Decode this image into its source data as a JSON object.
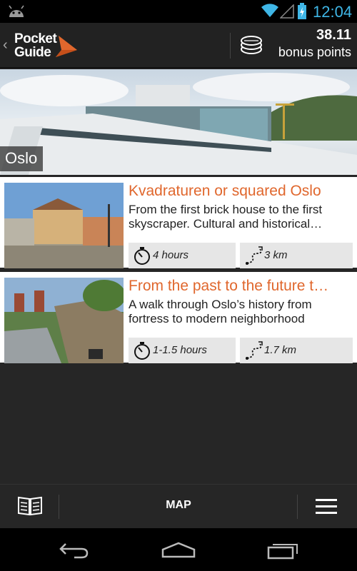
{
  "status_bar": {
    "time": "12:04"
  },
  "header": {
    "logo_line1": "Pocket",
    "logo_line2": "Guide",
    "bonus_points_value": "38.11",
    "bonus_points_label": "bonus points",
    "accent_color": "#e0672d"
  },
  "hero": {
    "city": "Oslo"
  },
  "tours": [
    {
      "title": "Kvadraturen or squared Oslo",
      "description": "From the first brick house to the first skyscraper. Cultural and historical…",
      "duration": "4 hours",
      "distance": "3 km"
    },
    {
      "title": "From the past to the future t…",
      "description": "A walk through Oslo’s history from fortress to modern neighborhood",
      "duration": "1-1.5 hours",
      "distance": "1.7 km"
    }
  ],
  "bottom_bar": {
    "map_label": "MAP",
    "left_icon": "book-icon",
    "right_icon": "menu-icon"
  },
  "nav_bar": {
    "icons": [
      "back-icon",
      "home-icon",
      "recents-icon"
    ]
  }
}
